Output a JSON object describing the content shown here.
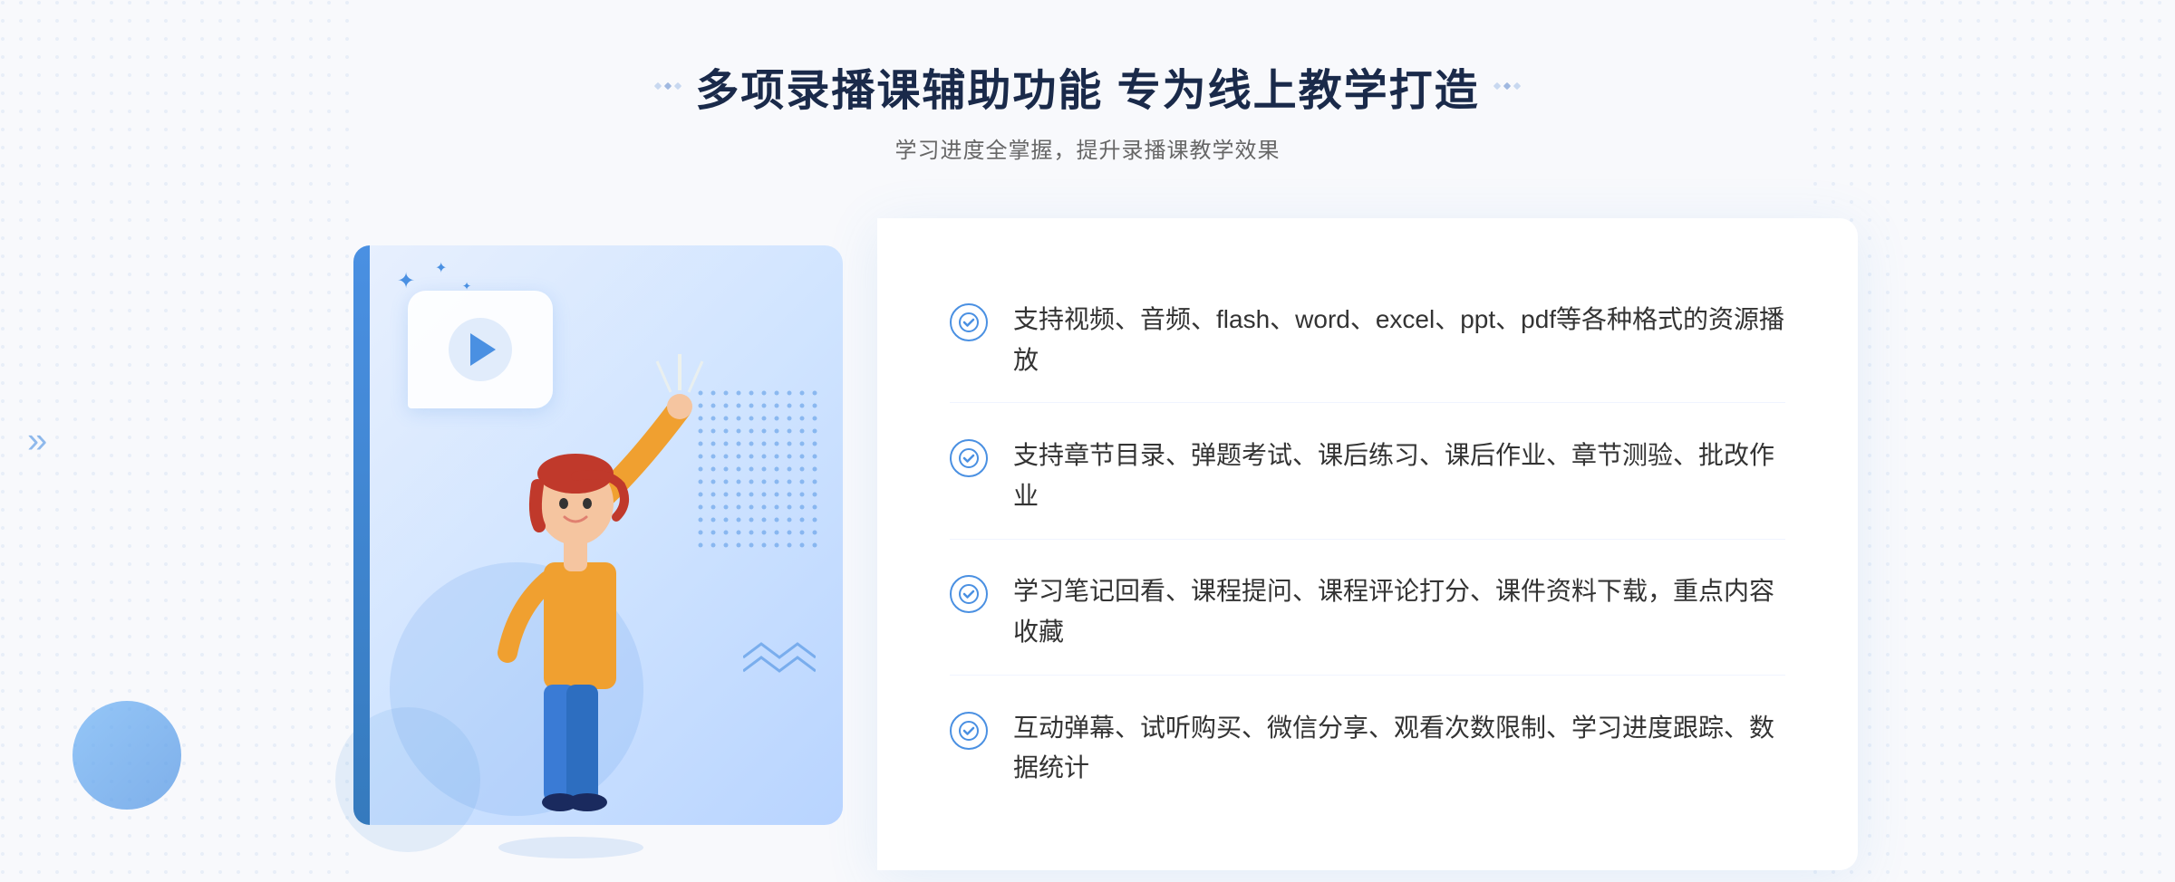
{
  "page": {
    "background_color": "#f5f7fc"
  },
  "header": {
    "main_title": "多项录播课辅助功能 专为线上教学打造",
    "sub_title": "学习进度全掌握，提升录播课教学效果",
    "decoration_left": "❖",
    "decoration_right": "❖"
  },
  "features": [
    {
      "id": 1,
      "text": "支持视频、音频、flash、word、excel、ppt、pdf等各种格式的资源播放"
    },
    {
      "id": 2,
      "text": "支持章节目录、弹题考试、课后练习、课后作业、章节测验、批改作业"
    },
    {
      "id": 3,
      "text": "学习笔记回看、课程提问、课程评论打分、课件资料下载，重点内容收藏"
    },
    {
      "id": 4,
      "text": "互动弹幕、试听购买、微信分享、观看次数限制、学习进度跟踪、数据统计"
    }
  ],
  "left_decoration": {
    "arrow": "»"
  },
  "colors": {
    "primary_blue": "#4a90e2",
    "light_blue": "#e8f0fe",
    "text_dark": "#1a2a4a",
    "text_gray": "#666666",
    "text_body": "#333333",
    "border_light": "#f0f4ff"
  }
}
